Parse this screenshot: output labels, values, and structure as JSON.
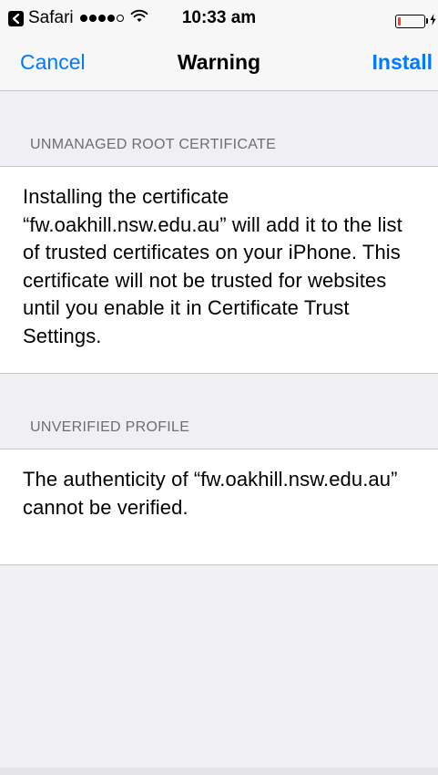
{
  "status_bar": {
    "back_app": "Safari",
    "time": "10:33 am",
    "signal_filled": 4,
    "signal_total": 5,
    "battery_level": 0.12,
    "battery_color": "#ff3b30"
  },
  "nav": {
    "cancel_label": "Cancel",
    "title": "Warning",
    "install_label": "Install",
    "accent_color": "#007aff"
  },
  "sections": [
    {
      "header": "UNMANAGED ROOT CERTIFICATE",
      "body": "Installing the certificate “fw.oakhill.nsw.edu.au” will add it to the list of trusted certificates on your iPhone. This certificate will not be trusted for websites until you enable it in Certificate Trust Settings."
    },
    {
      "header": "UNVERIFIED PROFILE",
      "body": "The authenticity of “fw.oakhill.nsw.edu.au” cannot be verified."
    }
  ]
}
